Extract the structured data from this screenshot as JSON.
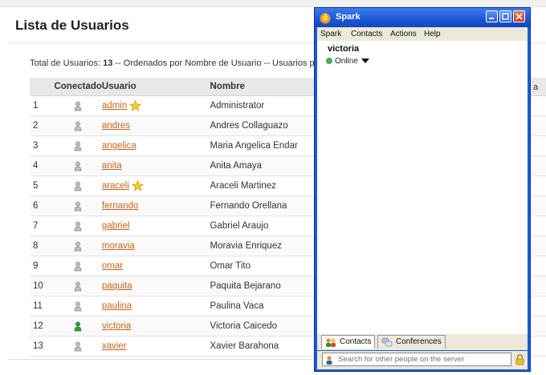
{
  "page": {
    "title": "Lista de Usuarios",
    "summary_prefix": "Total de Usuarios:",
    "summary_count": "13",
    "summary_suffix": " -- Ordenados por Nombre de Usuario -- Usuarios po",
    "right_cut_text": "a"
  },
  "table": {
    "headers": [
      "",
      "Conectado",
      "Usuario",
      "Nombre"
    ],
    "rows": [
      {
        "num": "1",
        "user": "admin",
        "name": "Administrator",
        "star": true,
        "online": false
      },
      {
        "num": "2",
        "user": "andres",
        "name": "Andres Collaguazo",
        "star": false,
        "online": false
      },
      {
        "num": "3",
        "user": "angelica",
        "name": "Maria Angelica Endar",
        "star": false,
        "online": false
      },
      {
        "num": "4",
        "user": "anita",
        "name": "Anita Amaya",
        "star": false,
        "online": false
      },
      {
        "num": "5",
        "user": "araceli",
        "name": "Araceli Martinez",
        "star": true,
        "online": false
      },
      {
        "num": "6",
        "user": "fernando",
        "name": "Fernando Orellana",
        "star": false,
        "online": false
      },
      {
        "num": "7",
        "user": "gabriel",
        "name": "Gabriel Araujo",
        "star": false,
        "online": false
      },
      {
        "num": "8",
        "user": "moravia",
        "name": "Moravia Enriquez",
        "star": false,
        "online": false
      },
      {
        "num": "9",
        "user": "omar",
        "name": "Omar Tito",
        "star": false,
        "online": false
      },
      {
        "num": "10",
        "user": "paquita",
        "name": "Paquita Bejarano",
        "star": false,
        "online": false
      },
      {
        "num": "11",
        "user": "paulina",
        "name": "Paulina Vaca",
        "star": false,
        "online": false
      },
      {
        "num": "12",
        "user": "victoria",
        "name": "Victoria Caicedo",
        "star": false,
        "online": true
      },
      {
        "num": "13",
        "user": "xavier",
        "name": "Xavier Barahona",
        "star": false,
        "online": false
      }
    ]
  },
  "spark": {
    "title": "Spark",
    "menu": [
      "Spark",
      "Contacts",
      "Actions",
      "Help"
    ],
    "user": "victoria",
    "status": "Online",
    "tabs": {
      "contacts": "Contacts",
      "conferences": "Conferences"
    },
    "search_placeholder": "Search for other people on the server"
  },
  "colors": {
    "link": "#c8651b",
    "spark_frame": "#1d5bd6",
    "online_green": "#3cb34a"
  }
}
